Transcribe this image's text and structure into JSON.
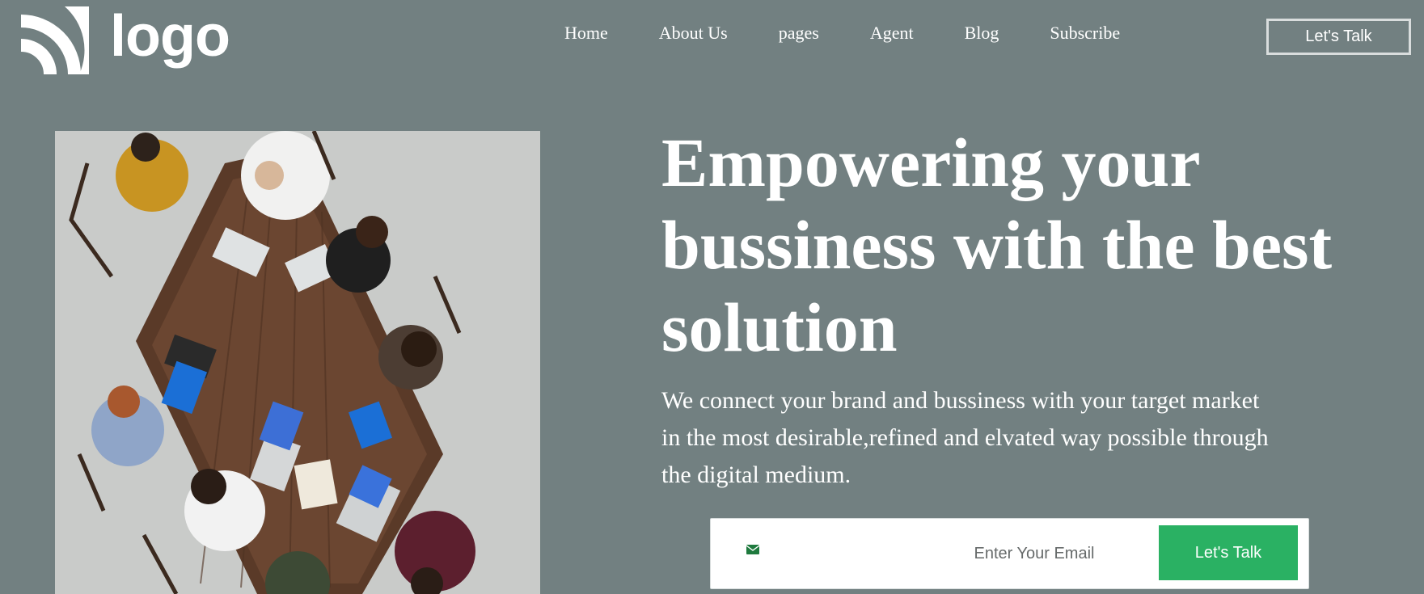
{
  "header": {
    "logo_text": "logo",
    "nav": [
      "Home",
      "About Us",
      "pages",
      "Agent",
      "Blog",
      "Subscribe"
    ],
    "cta_label": "Let's Talk"
  },
  "hero": {
    "image_icon": "team-meeting-photo",
    "headline": "Empowering your bussiness with the best solution",
    "subtext": "We connect your brand and bussiness with your target market in the most desirable,refined and elvated way possible through the digital medium."
  },
  "form": {
    "email_placeholder": "Enter Your Email",
    "submit_label": "Let's Talk",
    "icon": "envelope-icon"
  },
  "colors": {
    "background": "#728081",
    "accent_green": "#2ab163",
    "text": "#ffffff"
  }
}
